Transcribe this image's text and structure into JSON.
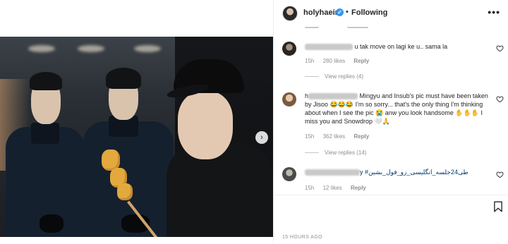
{
  "post": {
    "username": "holyhaein",
    "separator": "•",
    "follow_status": "Following",
    "more_glyph": "•••",
    "verified_glyph": "✓",
    "next_glyph": "›",
    "timestamp": "15 HOURS AGO"
  },
  "comments": [
    {
      "text": "u tak move on lagi ke u.. sama la",
      "age": "15h",
      "likes": "280 likes",
      "reply": "Reply",
      "view_replies": "View replies (4)"
    },
    {
      "text_start": "h",
      "text": "Mingyu and Insub's pic must have been taken by Jisoo 😂😂😂 I'm so sorry... that's the only thing I'm thinking about when I see the pic 😭 anw you look handsome ✋✋✋ I miss you and Snowdrop 🤍🙏",
      "age": "15h",
      "likes": "362 likes",
      "reply": "Reply",
      "view_replies": "View replies (14)"
    },
    {
      "text_start": "y",
      "hashtag": "#طی24جلسه_انگلیسی_زو_فول_بشین",
      "age": "15h",
      "likes": "12 likes",
      "reply": "Reply"
    }
  ],
  "icons": {
    "more": "more-icon",
    "heart": "heart-icon",
    "bookmark": "bookmark-icon",
    "verified": "verified-badge-icon",
    "next": "chevron-right-icon"
  },
  "colors": {
    "verified": "#3897f0",
    "hashtag": "#00376b",
    "meta_text": "#8e8e8e"
  }
}
